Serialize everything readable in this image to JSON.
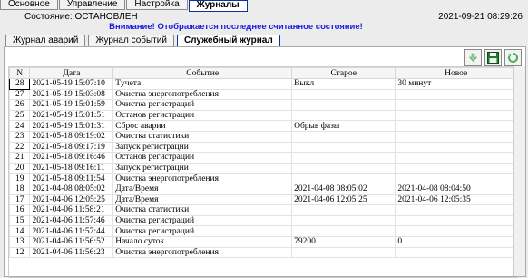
{
  "top_tabs": [
    "Основное",
    "Управление",
    "Настройка",
    "Журналы"
  ],
  "status": {
    "label": "Состояние: ОСТАНОВЛЕН",
    "datetime": "2021-09-21  08:29:26"
  },
  "warning": "Внимание! Отображается последнее считанное состояние!",
  "sub_tabs": [
    "Журнал аварий",
    "Журнал событий",
    "Служебный журнал"
  ],
  "toolbar": {
    "download_icon": "download-arrow-icon",
    "save_icon": "floppy-save-icon",
    "refresh_icon": "refresh-icon"
  },
  "table": {
    "headers": [
      "N",
      "Дата",
      "Событие",
      "Старое",
      "Новое"
    ],
    "rows": [
      [
        "28",
        "2021-05-19 15:07:10",
        "Tучета",
        "Выкл",
        "30 минут"
      ],
      [
        "27",
        "2021-05-19 15:03:08",
        "Очистка энергопотребления",
        "",
        ""
      ],
      [
        "26",
        "2021-05-19 15:01:59",
        "Очистка регистраций",
        "",
        ""
      ],
      [
        "25",
        "2021-05-19 15:01:51",
        "Останов регистрации",
        "",
        ""
      ],
      [
        "24",
        "2021-05-19 15:01:31",
        "Сброс аварии",
        "Обрыв фазы",
        ""
      ],
      [
        "23",
        "2021-05-18 09:19:02",
        "Очистка статистики",
        "",
        ""
      ],
      [
        "22",
        "2021-05-18 09:17:19",
        "Запуск регистрации",
        "",
        ""
      ],
      [
        "21",
        "2021-05-18 09:16:46",
        "Останов регистрации",
        "",
        ""
      ],
      [
        "20",
        "2021-05-18 09:16:11",
        "Запуск регистрации",
        "",
        ""
      ],
      [
        "19",
        "2021-05-18 09:11:54",
        "Очистка энергопотребления",
        "",
        ""
      ],
      [
        "18",
        "2021-04-08 08:05:02",
        "Дата/Время",
        "2021-04-08 08:05:02",
        "2021-04-08 08:04:50"
      ],
      [
        "17",
        "2021-04-06 12:05:25",
        "Дата/Время",
        "2021-04-06 12:05:25",
        "2021-04-06 12:05:35"
      ],
      [
        "16",
        "2021-04-06 11:58:21",
        "Очистка статистики",
        "",
        ""
      ],
      [
        "15",
        "2021-04-06 11:57:46",
        "Очистка регистраций",
        "",
        ""
      ],
      [
        "14",
        "2021-04-06 11:57:44",
        "Очистка регистраций",
        "",
        ""
      ],
      [
        "13",
        "2021-04-06 11:56:52",
        "Начало суток",
        "79200",
        "0"
      ],
      [
        "12",
        "2021-04-06 11:56:23",
        "Очистка энергопотребления",
        "",
        ""
      ]
    ]
  }
}
